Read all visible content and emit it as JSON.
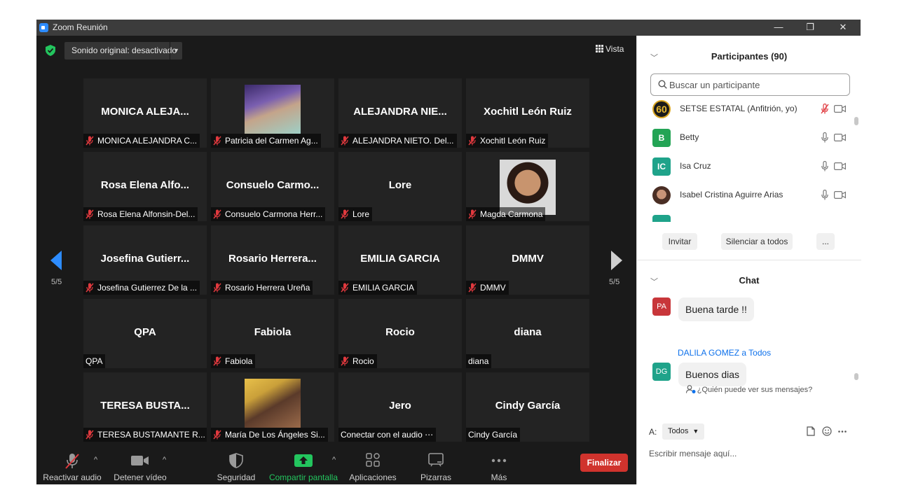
{
  "window": {
    "title": "Zoom Reunión",
    "minimize": "—",
    "restore": "❐",
    "close": "✕"
  },
  "meeting": {
    "sound_button": "Sonido original: desactivado",
    "view_button": "Vista",
    "page_left": "5/5",
    "page_right": "5/5",
    "tiles": [
      {
        "big": "MONICA ALEJA...",
        "label": "MONICA ALEJANDRA C...",
        "muted": true
      },
      {
        "big": "",
        "label": "Patricia del Carmen  Ag...",
        "muted": true,
        "photo": true
      },
      {
        "big": "ALEJANDRA NIE...",
        "label": "ALEJANDRA NIETO.  Del...",
        "muted": true
      },
      {
        "big": "Xochitl León Ruiz",
        "label": "Xochitl León Ruiz",
        "muted": true
      },
      {
        "big": "Rosa Elena Alfo...",
        "label": "Rosa Elena Alfonsin-Del...",
        "muted": true
      },
      {
        "big": "Consuelo  Carmo...",
        "label": "Consuelo Carmona Herr...",
        "muted": true
      },
      {
        "big": "Lore",
        "label": "Lore",
        "muted": true
      },
      {
        "big": "",
        "label": "Magda Carmona",
        "muted": true,
        "photo": true
      },
      {
        "big": "Josefina  Gutierr...",
        "label": "Josefina Gutierrez De la ...",
        "muted": true
      },
      {
        "big": "Rosario  Herrera...",
        "label": "Rosario Herrera Ureña",
        "muted": true
      },
      {
        "big": "EMILIA GARCIA",
        "label": "EMILIA GARCIA",
        "muted": true
      },
      {
        "big": "DMMV",
        "label": "DMMV",
        "muted": true
      },
      {
        "big": "QPA",
        "label": "QPA",
        "muted": false
      },
      {
        "big": "Fabiola",
        "label": "Fabiola",
        "muted": true
      },
      {
        "big": "Rocio",
        "label": "Rocio",
        "muted": true
      },
      {
        "big": "diana",
        "label": "diana",
        "muted": false
      },
      {
        "big": "TERESA  BUSTA...",
        "label": "TERESA BUSTAMANTE R...",
        "muted": true
      },
      {
        "big": "",
        "label": "María De Los Ángeles Si...",
        "muted": true,
        "photo": true
      },
      {
        "big": "Jero",
        "label": "Conectar con el audio ⋯",
        "muted": false
      },
      {
        "big": "Cindy García",
        "label": "Cindy García",
        "muted": false
      }
    ]
  },
  "toolbar": {
    "audio": "Reactivar audio",
    "video": "Detener vídeo",
    "security": "Seguridad",
    "share": "Compartir pantalla",
    "apps": "Aplicaciones",
    "whiteboards": "Pizarras",
    "more": "Más",
    "end": "Finalizar"
  },
  "participants": {
    "title": "Participantes (90)",
    "search_placeholder": "Buscar un participante",
    "list": [
      {
        "initials": "60",
        "name": "SETSE ESTATAL (Anfitrión, yo)",
        "color": "#1a1a1a",
        "muted": true
      },
      {
        "initials": "B",
        "name": "Betty",
        "color": "#23a455",
        "muted": false
      },
      {
        "initials": "IC",
        "name": "Isa Cruz",
        "color": "#1fa38a",
        "muted": false
      },
      {
        "initials": "",
        "name": "Isabel Cristina Aguirre Arias",
        "color": "#8a6a5a",
        "muted": false
      }
    ],
    "invite": "Invitar",
    "mute_all": "Silenciar a todos",
    "more": "..."
  },
  "chat": {
    "title": "Chat",
    "messages": [
      {
        "initials": "PA",
        "color": "#c8363a",
        "text": "Buena tarde !!"
      },
      {
        "initials": "DG",
        "color": "#1fa38a",
        "text": "Buenos dias",
        "sender": "DALILA GOMEZ a Todos"
      }
    ],
    "who_can_see": "¿Quién puede ver sus mensajes?",
    "to_label": "A:",
    "to_value": "Todos",
    "input_placeholder": "Escribir mensaje aquí..."
  }
}
